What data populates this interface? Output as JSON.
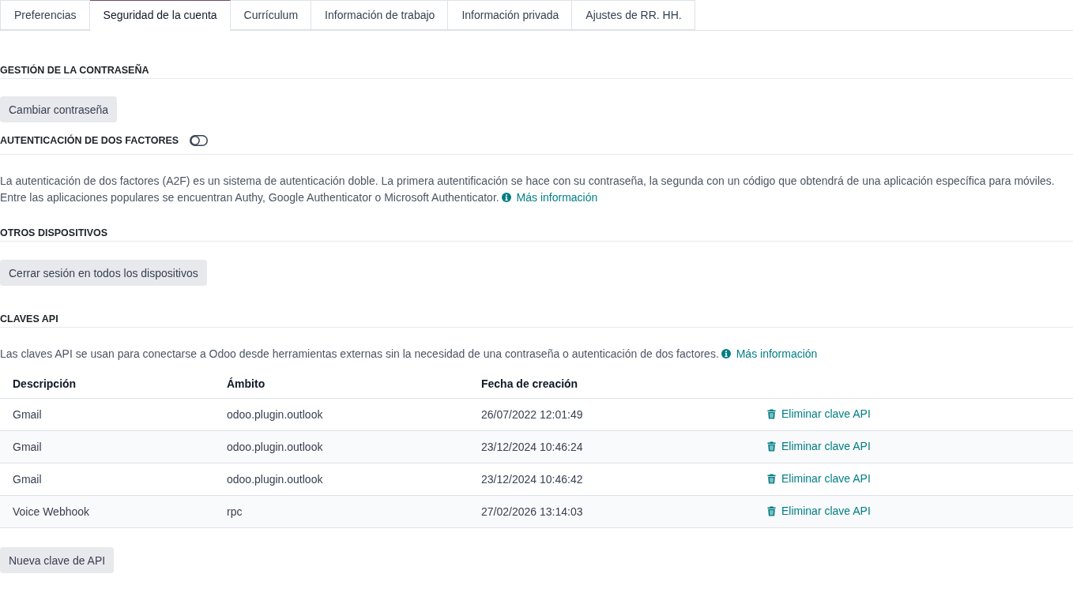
{
  "tabs": [
    {
      "label": "Preferencias",
      "selected": false
    },
    {
      "label": "Seguridad de la cuenta",
      "selected": true
    },
    {
      "label": "Currículum",
      "selected": false
    },
    {
      "label": "Información de trabajo",
      "selected": false
    },
    {
      "label": "Información privada",
      "selected": false
    },
    {
      "label": "Ajustes de RR. HH.",
      "selected": false
    }
  ],
  "password_management": {
    "heading": "GESTIÓN DE LA CONTRASEÑA",
    "button": "Cambiar contraseña"
  },
  "two_factor": {
    "heading": "AUTENTICACIÓN DE DOS FACTORES",
    "enabled": false,
    "description": "La autenticación de dos factores (A2F) es un sistema de autenticación doble. La primera autentificación se hace con su contraseña, la segunda con un código que obtendrá de una aplicación específica para móviles. Entre las aplicaciones populares se encuentran Authy, Google Authenticator o Microsoft Authenticator.",
    "link": "Más información"
  },
  "other_devices": {
    "heading": "OTROS DISPOSITIVOS",
    "button": "Cerrar sesión en todos los dispositivos"
  },
  "api_keys": {
    "heading": "CLAVES API",
    "description": "Las claves API se usan para conectarse a Odoo desde herramientas externas sin la necesidad de una contraseña o autenticación de dos factores.",
    "link": "Más información",
    "table": {
      "columns": [
        "Descripción",
        "Ámbito",
        "Fecha de creación"
      ],
      "rows": [
        {
          "cells": [
            "Gmail",
            "odoo.plugin.outlook",
            "26/07/2022 12:01:49"
          ],
          "action": "Eliminar clave API"
        },
        {
          "cells": [
            "Gmail",
            "odoo.plugin.outlook",
            "23/12/2024 10:46:24"
          ],
          "action": "Eliminar clave API"
        },
        {
          "cells": [
            "Gmail",
            "odoo.plugin.outlook",
            "23/12/2024 10:46:42"
          ],
          "action": "Eliminar clave API"
        },
        {
          "cells": [
            "Voice Webhook",
            "rpc",
            "27/02/2026 13:14:03"
          ],
          "action": "Eliminar clave API"
        }
      ]
    },
    "button": "Nueva clave de API"
  }
}
